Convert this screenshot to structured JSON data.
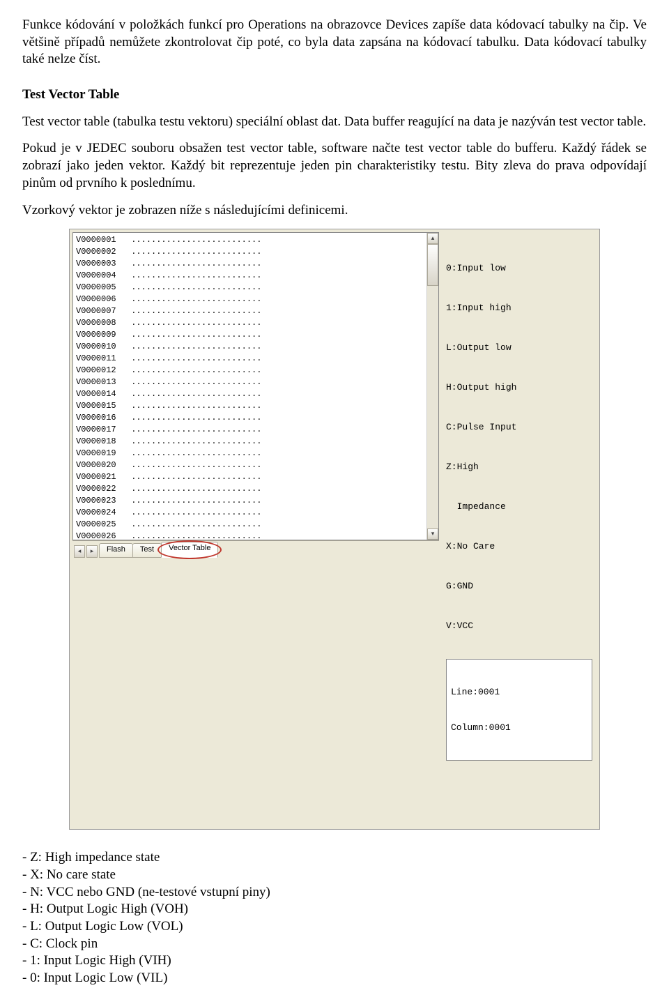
{
  "para1": "Funkce kódování v položkách funkcí pro Operations na obrazovce Devices zapíše data kódovací tabulky na čip. Ve většině případů nemůžete zkontrolovat čip poté, co byla data zapsána na kódovací tabulku. Data kódovací tabulky také nelze číst.",
  "heading": "Test Vector Table",
  "para2": "Test vector table (tabulka testu vektoru) speciální oblast dat. Data buffer reagující na data je nazýván test vector table.",
  "para3": "Pokud je v JEDEC souboru obsažen test vector table, software načte test vector table do bufferu. Každý řádek se zobrazí jako jeden vektor. Každý bit reprezentuje jeden pin charakteristiky testu. Bity zleva do prava odpovídají pinům od prvního k poslednímu.",
  "para4": "Vzorkový vektor je zobrazen níže s následujícími definicemi.",
  "vector_rows": [
    "V0000001",
    "V0000002",
    "V0000003",
    "V0000004",
    "V0000005",
    "V0000006",
    "V0000007",
    "V0000008",
    "V0000009",
    "V0000010",
    "V0000011",
    "V0000012",
    "V0000013",
    "V0000014",
    "V0000015",
    "V0000016",
    "V0000017",
    "V0000018",
    "V0000019",
    "V0000020",
    "V0000021",
    "V0000022",
    "V0000023",
    "V0000024",
    "V0000025",
    "V0000026"
  ],
  "dots": "..........................",
  "legend": {
    "l0": "0:Input low",
    "l1": "1:Input high",
    "lL": "L:Output low",
    "lH": "H:Output high",
    "lC": "C:Pulse Input",
    "lZ1": "Z:High",
    "lZ2": "  Impedance",
    "lX": "X:No Care",
    "lG": "G:GND",
    "lV": "V:VCC"
  },
  "pos": {
    "line": "Line:0001",
    "col": "Column:0001"
  },
  "tabs": {
    "flash": "Flash",
    "test": "Test",
    "vt": "Vector Table"
  },
  "bullets": {
    "z": "- Z: High impedance state",
    "x": "- X: No care state",
    "n": "- N: VCC nebo GND (ne-testové vstupní piny)",
    "h": "- H: Output Logic High (VOH)",
    "l": "- L: Output Logic Low (VOL)",
    "c": "- C: Clock pin",
    "1": "- 1: Input Logic High (VIH)",
    "0": "- 0: Input Logic Low (VIL)"
  }
}
